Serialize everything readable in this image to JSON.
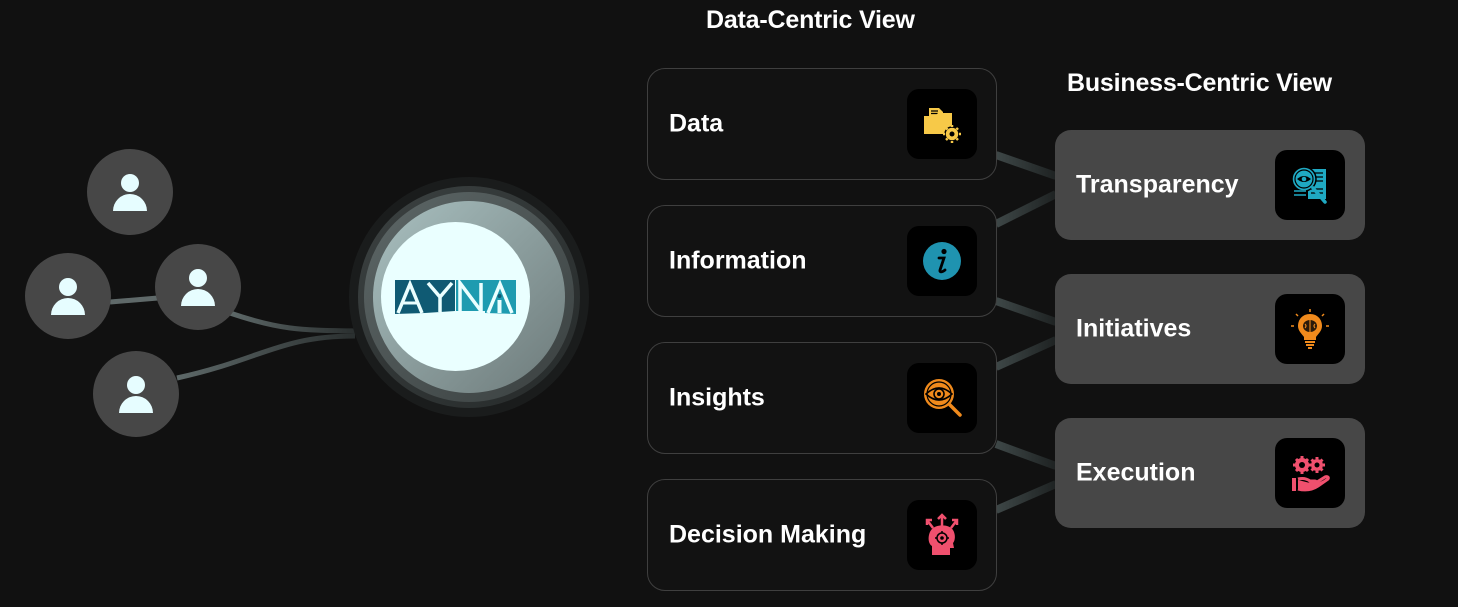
{
  "headings": {
    "data_centric": "Data-Centric View",
    "business_centric": "Business-Centric View"
  },
  "hub": {
    "logo_text": "AYNA",
    "logo_colors": {
      "dark": "#0f5a73",
      "light": "#1e9bb0",
      "background": "#eaffff"
    }
  },
  "users": [
    {
      "icon": "user-icon"
    },
    {
      "icon": "user-icon"
    },
    {
      "icon": "user-icon"
    },
    {
      "icon": "user-icon"
    }
  ],
  "data_centric_items": [
    {
      "label": "Data",
      "icon": "folder-gear-icon",
      "color": "#f7c948"
    },
    {
      "label": "Information",
      "icon": "info-icon",
      "color": "#1f93b0"
    },
    {
      "label": "Insights",
      "icon": "eye-search-icon",
      "color": "#f08a1c"
    },
    {
      "label": "Decision Making",
      "icon": "head-gear-arrows-icon",
      "color": "#f0506e"
    }
  ],
  "business_centric_items": [
    {
      "label": "Transparency",
      "icon": "document-eye-search-icon",
      "color": "#1fa9c2"
    },
    {
      "label": "Initiatives",
      "icon": "lightbulb-brain-icon",
      "color": "#f08a1c"
    },
    {
      "label": "Execution",
      "icon": "hand-gears-icon",
      "color": "#f0506e"
    }
  ],
  "colors": {
    "background": "#111111",
    "node_fill": "#474747",
    "user_glyph": "#e6fdff",
    "card_border": "#3f3f3f",
    "connector": "#4e5757"
  }
}
